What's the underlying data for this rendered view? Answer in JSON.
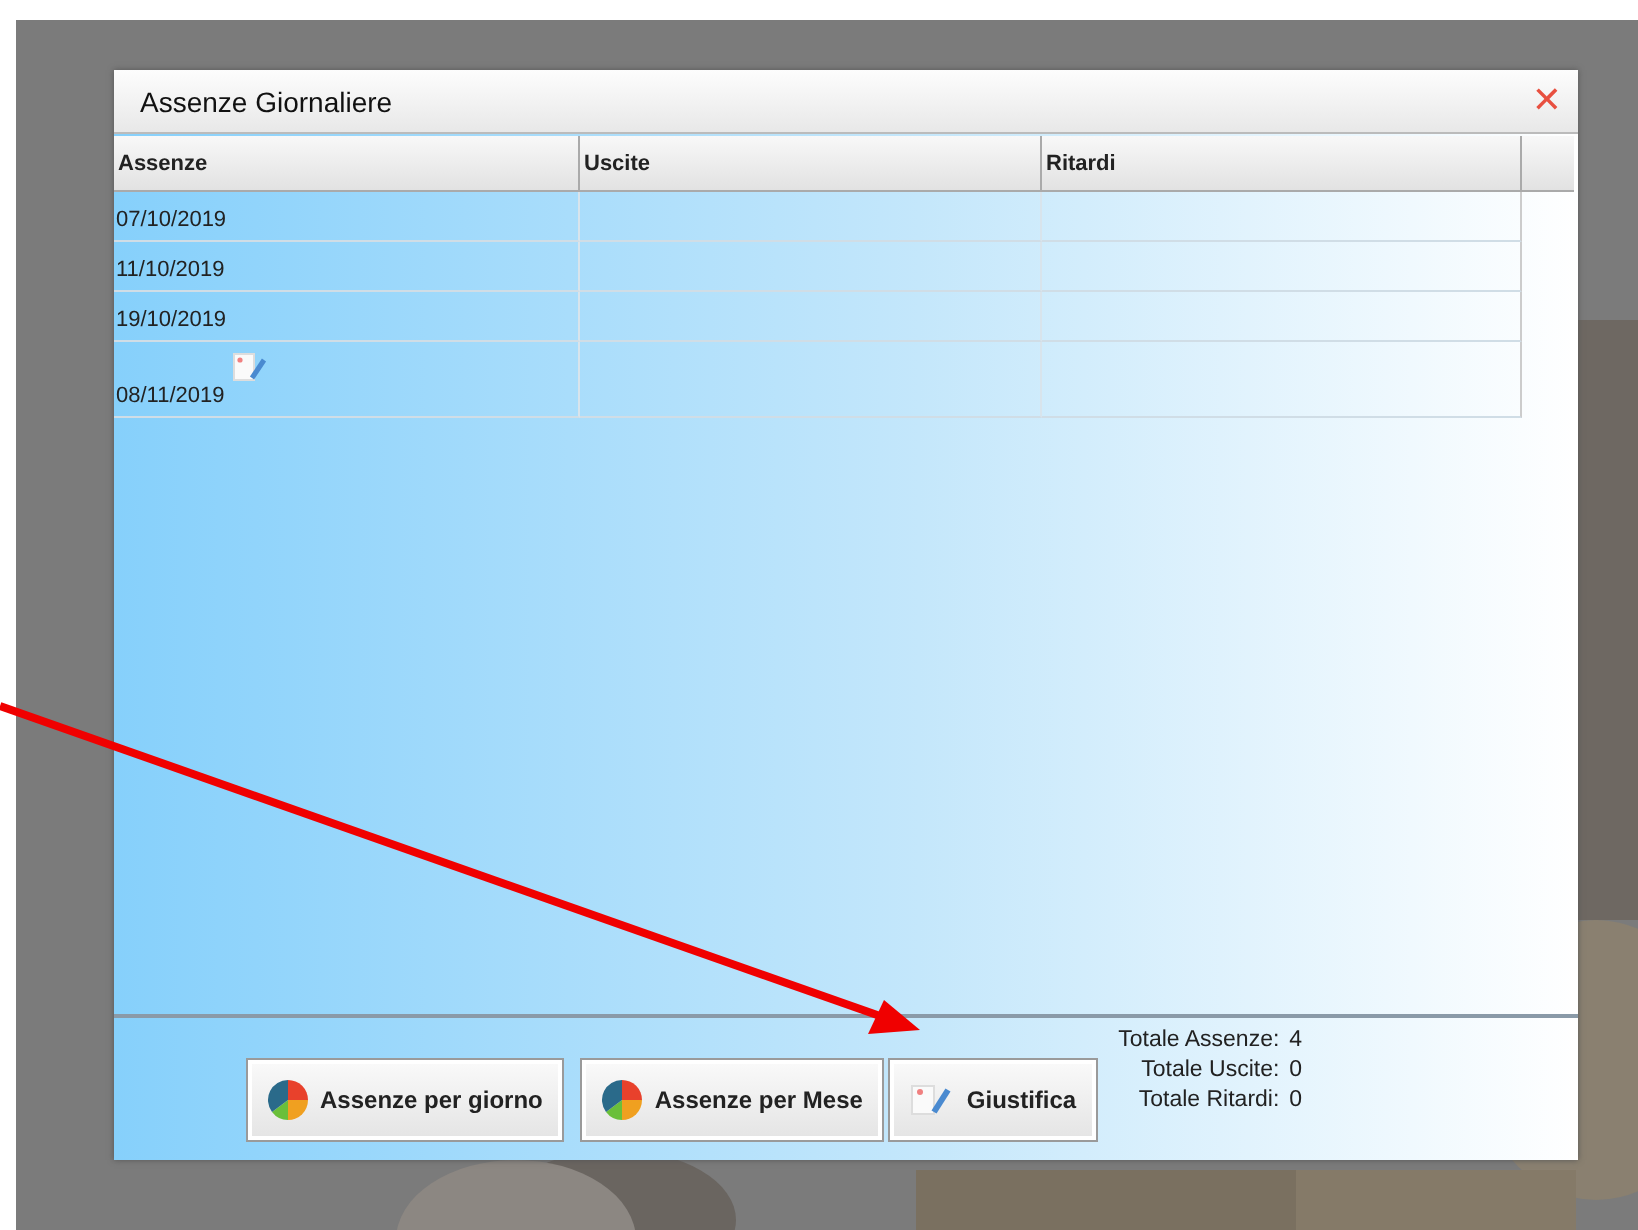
{
  "dialog": {
    "title": "Assenze Giornaliere",
    "close": "✕"
  },
  "table": {
    "columns": [
      "Assenze",
      "Uscite",
      "Ritardi"
    ],
    "rows": [
      {
        "cells": [
          "07/10/2019",
          "",
          ""
        ],
        "has_note": false
      },
      {
        "cells": [
          "11/10/2019",
          "",
          ""
        ],
        "has_note": false
      },
      {
        "cells": [
          "19/10/2019",
          "",
          ""
        ],
        "has_note": false
      },
      {
        "cells": [
          "08/11/2019",
          "",
          ""
        ],
        "has_note": true
      }
    ]
  },
  "buttons": [
    {
      "label": "Assenze per giorno",
      "kind": "chart"
    },
    {
      "label": "Assenze per Mese",
      "kind": "chart"
    },
    {
      "label": "Giustifica",
      "kind": "note"
    }
  ],
  "totals": [
    {
      "label": "Totale Assenze:",
      "value": "4"
    },
    {
      "label": "Totale Uscite:",
      "value": "0"
    },
    {
      "label": "Totale Ritardi:",
      "value": "0"
    }
  ],
  "annotation": {
    "kind": "arrow"
  }
}
